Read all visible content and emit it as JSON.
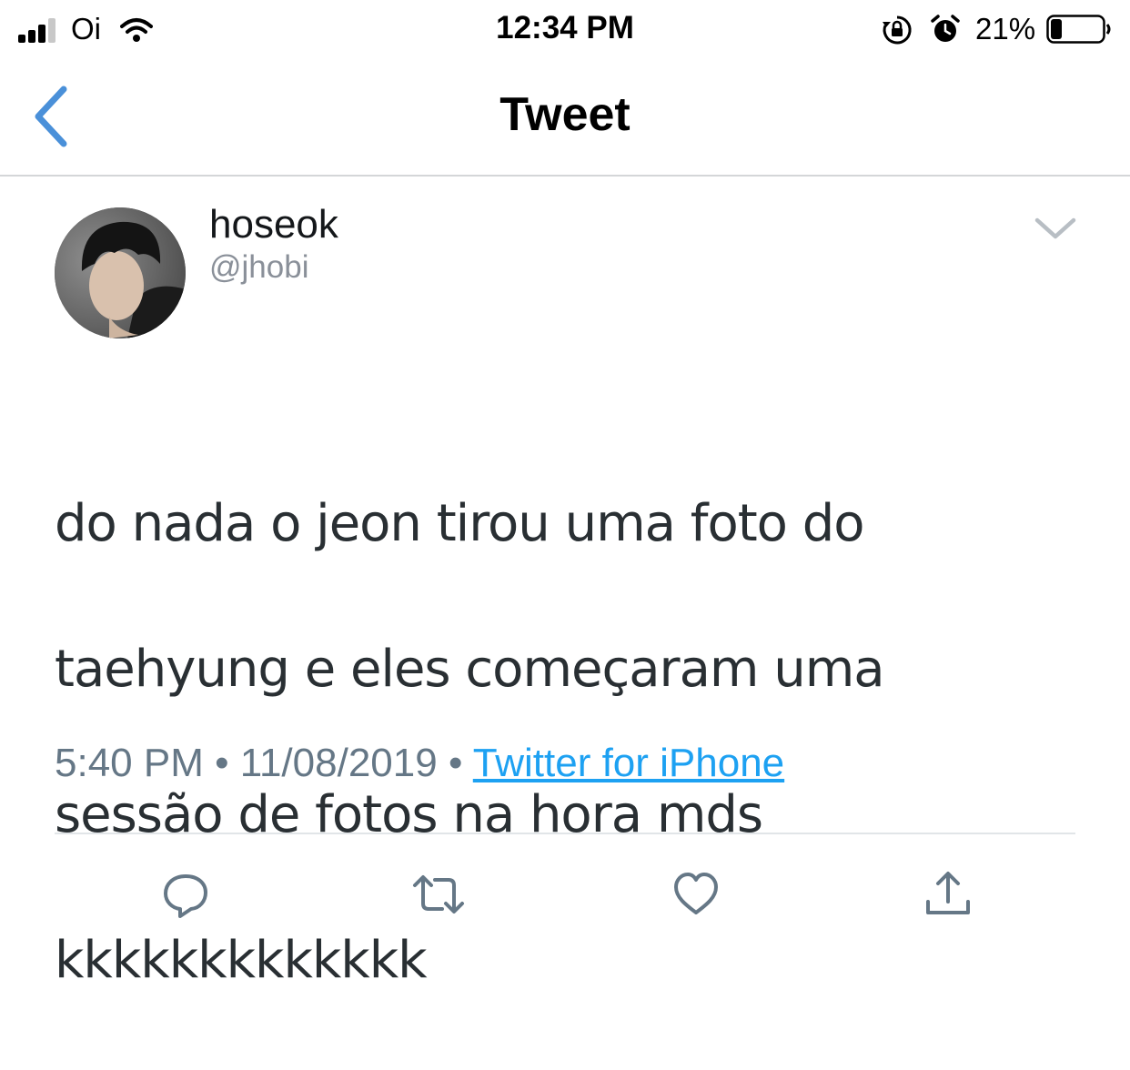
{
  "status_bar": {
    "carrier": "Oi",
    "time": "12:34 PM",
    "battery_percent": "21%",
    "battery_level": 0.21,
    "signal_bars": 3,
    "icons": [
      "signal-icon",
      "wifi-icon",
      "rotation-lock-icon",
      "alarm-icon",
      "battery-icon"
    ]
  },
  "nav": {
    "title": "Tweet",
    "back_icon": "chevron-left-icon"
  },
  "tweet": {
    "display_name": "hoseok",
    "handle": "@jhobi",
    "text_lines": [
      "do nada o jeon tirou uma foto do",
      "taehyung e eles começaram uma",
      "sessão de fotos na hora mds",
      "kkkkkkkkkkkkk"
    ],
    "time": "5:40 PM",
    "date": "11/08/2019",
    "separator": "•",
    "source": "Twitter for iPhone",
    "menu_icon": "chevron-down-icon"
  },
  "actions": [
    {
      "name": "reply",
      "icon": "reply-icon"
    },
    {
      "name": "retweet",
      "icon": "retweet-icon"
    },
    {
      "name": "like",
      "icon": "heart-icon"
    },
    {
      "name": "share",
      "icon": "share-icon"
    }
  ],
  "colors": {
    "accent": "#1da1f2",
    "back_chevron": "#4a90d9",
    "secondary_text": "#657786",
    "icon_gray": "#657786"
  }
}
